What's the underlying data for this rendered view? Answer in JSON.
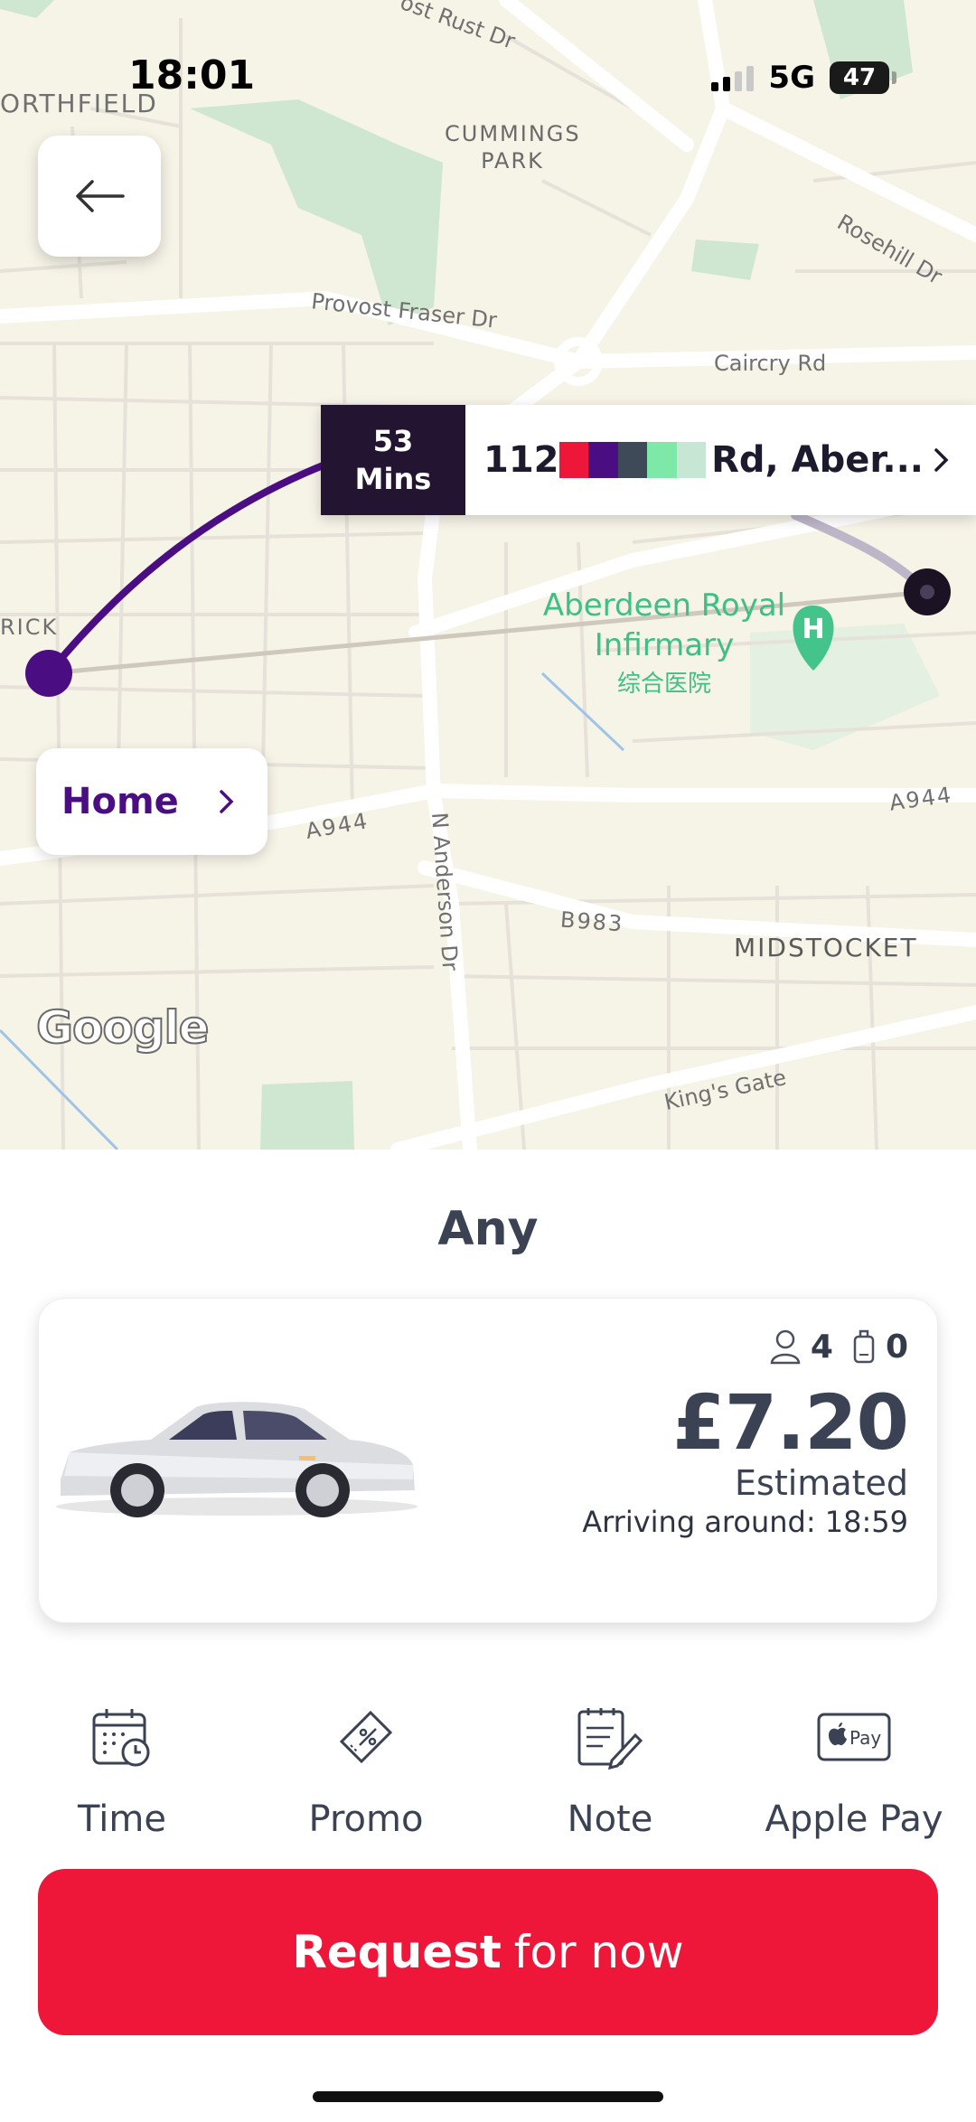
{
  "status_bar": {
    "time": "18:01",
    "network": "5G",
    "battery": "47"
  },
  "map": {
    "labels": {
      "northfield": "ORTHFIELD",
      "cummings_park_1": "CUMMINGS",
      "cummings_park_2": "PARK",
      "rust_dr": "ost Rust Dr",
      "rosehill_dr": "Rosehill Dr",
      "provost_fraser": "Provost Fraser Dr",
      "caircry_rd": "Caircry Rd",
      "rick": "RICK",
      "hospital_1": "Aberdeen Royal",
      "hospital_2": "Infirmary",
      "hospital_3": "综合医院",
      "a944_left": "A944",
      "a944_right": "A944",
      "n_anderson": "N Anderson Dr",
      "b983": "B983",
      "midstocket": "MIDSTOCKET",
      "kings_gate": "King's Gate",
      "google": "Google"
    },
    "eta": {
      "value": "53",
      "unit": "Mins"
    },
    "destination": {
      "prefix": "112",
      "suffix": "Rd, Aber..."
    },
    "home_label": "Home",
    "route_color": "#4b0e82"
  },
  "sheet": {
    "title": "Any",
    "ride": {
      "passengers": "4",
      "luggage": "0",
      "price": "£7.20",
      "estimated_label": "Estimated",
      "arriving": "Arriving around: 18:59"
    },
    "options": [
      {
        "label": "Time",
        "icon": "calendar-clock-icon"
      },
      {
        "label": "Promo",
        "icon": "promo-ticket-icon"
      },
      {
        "label": "Note",
        "icon": "note-pencil-icon"
      },
      {
        "label": "Apple Pay",
        "icon": "apple-pay-icon"
      }
    ],
    "request": {
      "bold": "Request",
      "rest": "for now",
      "color": "#ee1639"
    }
  }
}
